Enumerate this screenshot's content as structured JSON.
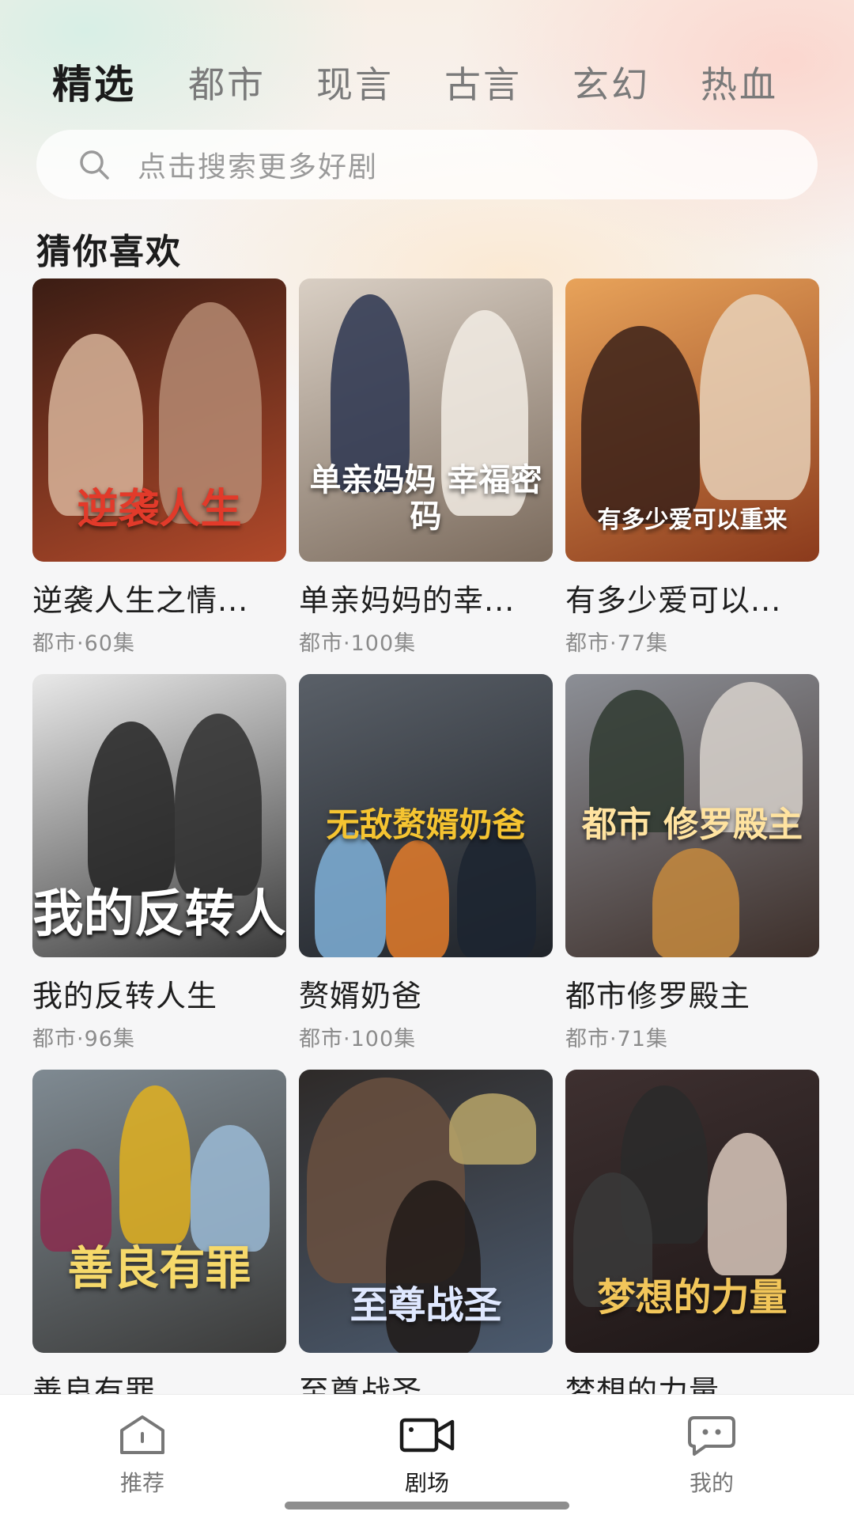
{
  "tabs": [
    {
      "label": "精选",
      "active": true
    },
    {
      "label": "都市",
      "active": false
    },
    {
      "label": "现言",
      "active": false
    },
    {
      "label": "古言",
      "active": false
    },
    {
      "label": "玄幻",
      "active": false
    },
    {
      "label": "热血",
      "active": false
    }
  ],
  "search": {
    "placeholder": "点击搜索更多好剧",
    "icon": "search-icon"
  },
  "section": {
    "title": "猜你喜欢"
  },
  "dramas": [
    {
      "title": "逆袭人生之情...",
      "meta": "都市·60集",
      "poster_text": "逆袭人生",
      "colors": [
        "#3b1d14",
        "#b1492a"
      ]
    },
    {
      "title": "单亲妈妈的幸...",
      "meta": "都市·100集",
      "poster_text": "单亲妈妈 幸福密码",
      "colors": [
        "#d9cfc4",
        "#7a6a5c"
      ]
    },
    {
      "title": "有多少爱可以...",
      "meta": "都市·77集",
      "poster_text": "有多少爱可以重来",
      "colors": [
        "#e8a35a",
        "#8b3a1c"
      ]
    },
    {
      "title": "我的反转人生",
      "meta": "都市·96集",
      "poster_text": "我的反转人",
      "colors": [
        "#e9e9e9",
        "#3a3a3a"
      ]
    },
    {
      "title": "赘婿奶爸",
      "meta": "都市·100集",
      "poster_text": "无敌赘婿奶爸",
      "colors": [
        "#5a6068",
        "#1f2329"
      ]
    },
    {
      "title": "都市修罗殿主",
      "meta": "都市·71集",
      "poster_text": "都市 修罗殿主",
      "colors": [
        "#8c8f96",
        "#3d2f2a"
      ]
    },
    {
      "title": "善良有罪",
      "meta": "",
      "poster_text": "善良有罪",
      "colors": [
        "#7f8a92",
        "#3b3b3a"
      ]
    },
    {
      "title": "至尊战圣",
      "meta": "",
      "poster_text": "至尊战圣",
      "colors": [
        "#2e2a28",
        "#4b5a6e"
      ]
    },
    {
      "title": "梦想的力量",
      "meta": "",
      "poster_text": "梦想的力量",
      "colors": [
        "#3e3030",
        "#1d1616"
      ]
    }
  ],
  "bottom_nav": [
    {
      "label": "推荐",
      "icon": "home-icon",
      "active": false
    },
    {
      "label": "剧场",
      "icon": "video-camera-icon",
      "active": true
    },
    {
      "label": "我的",
      "icon": "chat-bubble-icon",
      "active": false
    }
  ]
}
